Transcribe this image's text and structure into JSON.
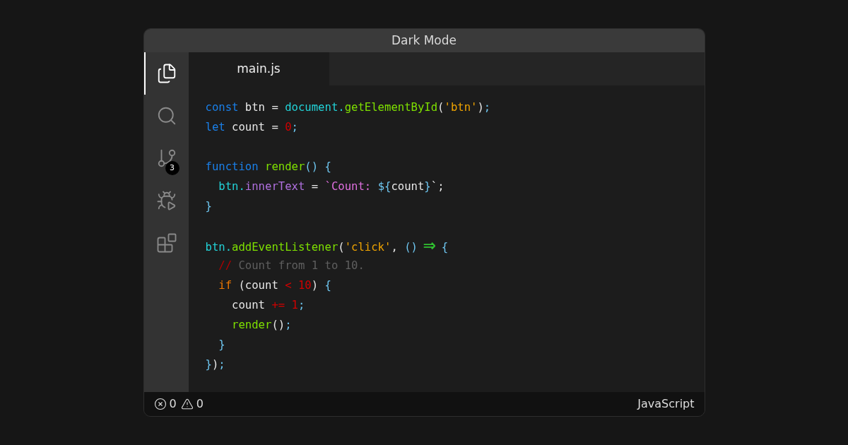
{
  "window": {
    "title": "Dark Mode"
  },
  "activity_bar": [
    {
      "kind": "files",
      "selected": true
    },
    {
      "kind": "search",
      "selected": false
    },
    {
      "kind": "source-control",
      "selected": false,
      "badge": "3"
    },
    {
      "kind": "debug",
      "selected": false
    },
    {
      "kind": "extensions",
      "selected": false
    }
  ],
  "tabs": [
    {
      "label": "main.js",
      "selected": true
    }
  ],
  "code_lines": [
    {
      "tokens": [
        {
          "text": "const",
          "color": "#1a80ea"
        },
        {
          "text": " btn = "
        },
        {
          "text": "document.",
          "color": "#22d3d8"
        },
        {
          "text": "getElementById",
          "color": "#7ee000"
        },
        {
          "text": "("
        },
        {
          "text": "'btn'",
          "color": "#f0a400"
        },
        {
          "text": ")"
        },
        {
          "text": ";",
          "color": "#6ec6f0"
        }
      ]
    },
    {
      "tokens": [
        {
          "text": "let",
          "color": "#1a80ea"
        },
        {
          "text": " count = "
        },
        {
          "text": "0",
          "color": "#d10000"
        },
        {
          "text": ";",
          "color": "#6ec6f0"
        }
      ]
    },
    {
      "gap_before": true,
      "tokens": [
        {
          "text": "function",
          "color": "#1a80ea"
        },
        {
          "text": " render",
          "color": "#7ee000"
        },
        {
          "text": "() {",
          "color": "#6ec6f0"
        }
      ]
    },
    {
      "tokens": [
        {
          "text": "  btn.",
          "color": "#22d3d8"
        },
        {
          "text": "innerText",
          "color": "#b070e0"
        },
        {
          "text": " = "
        },
        {
          "text": "`Count: ",
          "color": "#e070e0"
        },
        {
          "text": "${",
          "color": "#6ec6f0"
        },
        {
          "text": "count"
        },
        {
          "text": "}",
          "color": "#6ec6f0"
        },
        {
          "text": "`;"
        }
      ]
    },
    {
      "tokens": [
        {
          "text": "}",
          "color": "#6ec6f0"
        }
      ]
    },
    {
      "gap_before": true,
      "tokens": [
        {
          "text": "btn.",
          "color": "#22d3d8"
        },
        {
          "text": "addEventListener",
          "color": "#7ee000"
        },
        {
          "text": "("
        },
        {
          "text": "'click'",
          "color": "#f0a400"
        },
        {
          "text": ", "
        },
        {
          "text": "()",
          "color": "#6ec6f0"
        },
        {
          "text": " ⇒ ",
          "color": "#30c030",
          "kind": "arrow"
        },
        {
          "text": "{",
          "color": "#6ec6f0"
        }
      ]
    },
    {
      "tokens": [
        {
          "text": "  //",
          "color": "#b00000"
        },
        {
          "text": " Count from 1 to 10.",
          "color": "#5f5f5f"
        }
      ]
    },
    {
      "tokens": [
        {
          "text": "  if",
          "color": "#f07800"
        },
        {
          "text": " (count "
        },
        {
          "text": "< 10",
          "color": "#d10000"
        },
        {
          "text": ") "
        },
        {
          "text": "{",
          "color": "#6ec6f0"
        }
      ]
    },
    {
      "tokens": [
        {
          "text": "    count "
        },
        {
          "text": "+= 1",
          "color": "#d10000"
        },
        {
          "text": ";",
          "color": "#6ec6f0"
        }
      ]
    },
    {
      "tokens": [
        {
          "text": "    render",
          "color": "#7ee000"
        },
        {
          "text": "()"
        },
        {
          "text": ";",
          "color": "#6ec6f0"
        }
      ]
    },
    {
      "tokens": [
        {
          "text": "  }",
          "color": "#6ec6f0"
        }
      ]
    },
    {
      "tokens": [
        {
          "text": "}",
          "color": "#6ec6f0"
        },
        {
          "text": ")"
        },
        {
          "text": ";",
          "color": "#6ec6f0"
        }
      ]
    }
  ],
  "status_bar": {
    "errors": "0",
    "warnings": "0",
    "language": "JavaScript"
  }
}
